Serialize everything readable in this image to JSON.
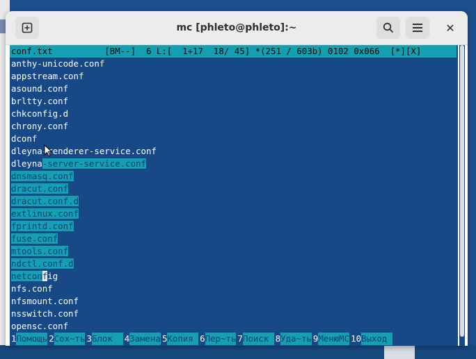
{
  "window": {
    "title": "mc [phleto@phleto]:~",
    "newtab_icon": "new-tab-icon",
    "search_icon": "search-icon",
    "menu_icon": "hamburger-menu-icon",
    "close_glyph": "✕"
  },
  "editor": {
    "status": "conf.txt          [BM--]  6 L:[  1+17  18/ 45] *(251 / 603b) 0102 0x066  [*][X]",
    "lines": [
      {
        "pre": "anthy-unicode.conf",
        "sel": ""
      },
      {
        "pre": "appstream.conf",
        "sel": ""
      },
      {
        "pre": "asound.conf",
        "sel": ""
      },
      {
        "pre": "brltty.conf",
        "sel": ""
      },
      {
        "pre": "chkconfig.d",
        "sel": ""
      },
      {
        "pre": "chrony.conf",
        "sel": ""
      },
      {
        "pre": "dconf",
        "sel": ""
      },
      {
        "pre": "dleyna-renderer-service.conf",
        "sel": ""
      },
      {
        "pre": "dleyna",
        "sel": "-server-service.conf"
      },
      {
        "pre": "",
        "sel": "dnsmasq.conf"
      },
      {
        "pre": "",
        "sel": "dracut.conf"
      },
      {
        "pre": "",
        "sel": "dracut.conf.d"
      },
      {
        "pre": "",
        "sel": "extlinux.conf"
      },
      {
        "pre": "",
        "sel": "fprintd.conf"
      },
      {
        "pre": "",
        "sel": "fuse.conf"
      },
      {
        "pre": "",
        "sel": "mtools.conf"
      },
      {
        "pre": "",
        "sel": "ndctl.conf.d"
      },
      {
        "pre": "",
        "sel": "netcon",
        "post": "fig",
        "cursor": "f"
      },
      {
        "pre": "nfs.conf",
        "sel": ""
      },
      {
        "pre": "nfsmount.conf",
        "sel": ""
      },
      {
        "pre": "nsswitch.conf",
        "sel": ""
      },
      {
        "pre": "opensc.conf",
        "sel": ""
      }
    ]
  },
  "fkeys": [
    {
      "num": "1",
      "label": "Помощь"
    },
    {
      "num": "2",
      "label": "Сох~ть"
    },
    {
      "num": "3",
      "label": "Блок  "
    },
    {
      "num": "4",
      "label": "Замена"
    },
    {
      "num": "5",
      "label": "Копия "
    },
    {
      "num": "6",
      "label": "Пер~ть"
    },
    {
      "num": "7",
      "label": "Поиск "
    },
    {
      "num": "8",
      "label": "Уда~ть"
    },
    {
      "num": "9",
      "label": "МенюMC"
    },
    {
      "num": "10",
      "label": "Выход "
    }
  ]
}
